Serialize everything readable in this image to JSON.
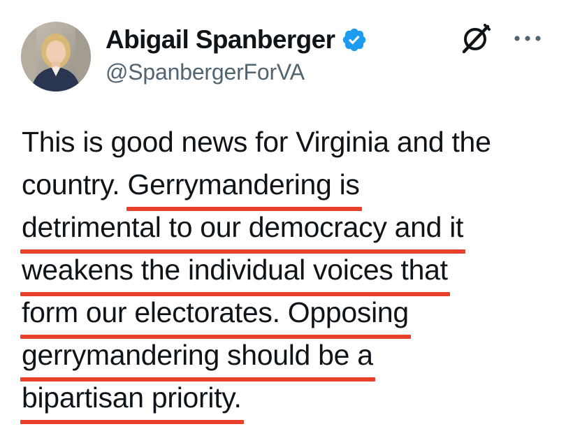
{
  "author": {
    "display_name": "Abigail Spanberger",
    "handle": "@SpanbergerForVA",
    "verified": true,
    "verified_badge_color": "#1d9bf0",
    "avatar_icon": "profile-photo",
    "platform_icon": "x-logo-icon",
    "menu_icon": "more-horizontal-icon"
  },
  "tweet": {
    "lines": [
      {
        "plain": "This is good news for Virginia and the",
        "highlighted": ""
      },
      {
        "plain": "country. ",
        "highlighted": "Gerrymandering is"
      },
      {
        "plain": "",
        "highlighted": "detrimental to our democracy and it"
      },
      {
        "plain": "",
        "highlighted": "weakens the individual voices that"
      },
      {
        "plain": "",
        "highlighted": "form our electorates. Opposing"
      },
      {
        "plain": "",
        "highlighted": "gerrymandering should be a"
      },
      {
        "plain": "",
        "highlighted": "bipartisan priority."
      }
    ]
  },
  "colors": {
    "text": "#0f1419",
    "handle": "#536471",
    "underline": "#e8402a"
  }
}
